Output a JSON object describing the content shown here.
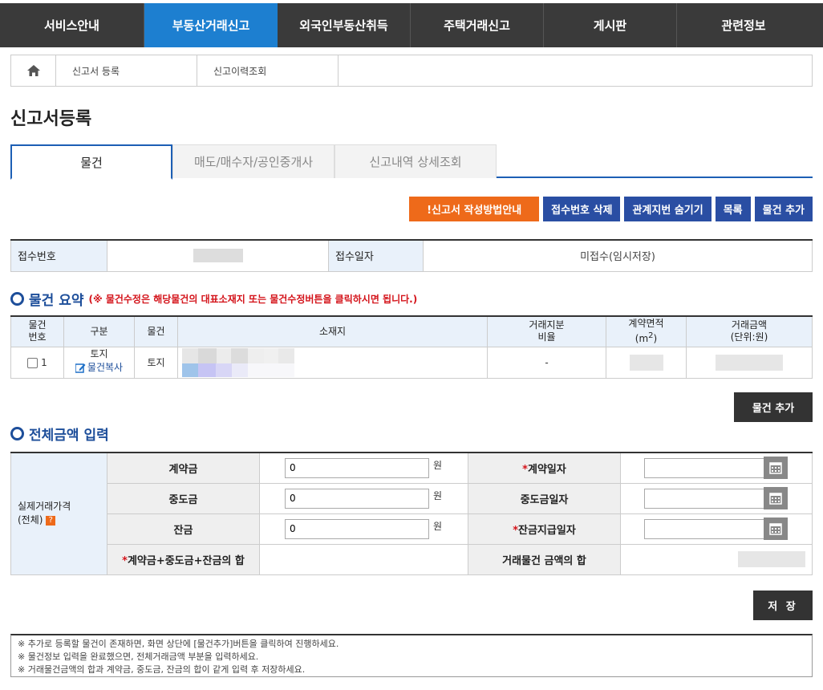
{
  "nav": {
    "items": [
      {
        "label": "서비스안내"
      },
      {
        "label": "부동산거래신고"
      },
      {
        "label": "외국인부동산취득"
      },
      {
        "label": "주택거래신고"
      },
      {
        "label": "게시판"
      },
      {
        "label": "관련정보"
      }
    ],
    "active_index": 1
  },
  "breadcrumb": {
    "items": [
      "신고서 등록",
      "신고이력조회"
    ]
  },
  "page_title": "신고서등록",
  "tabs": [
    {
      "label": "물건"
    },
    {
      "label": "매도/매수자/공인중개사"
    },
    {
      "label": "신고내역 상세조회"
    }
  ],
  "actions": {
    "guide": "!신고서 작성방법안내",
    "delete_receipt": "접수번호 삭제",
    "hide_lot": "관계지번 숨기기",
    "list": "목록",
    "add_item": "물건 추가"
  },
  "info": {
    "receipt_no_label": "접수번호",
    "receipt_date_label": "접수일자",
    "receipt_date_value": "미접수(임시저장)"
  },
  "summary": {
    "title": "물건 요약",
    "note": "(※ 물건수정은 해당물건의 대표소재지 또는 물건수정버튼을 클릭하시면 됩니다.)",
    "headers": {
      "no": "물건\n번호",
      "type": "구분",
      "item": "물건",
      "location": "소재지",
      "share": "거래지분\n비율",
      "area": "계약면적",
      "area_unit": "(m",
      "area_sup": "2",
      "area_close": ")",
      "amount": "거래금액",
      "amount_unit": "(단위:원)"
    },
    "rows": [
      {
        "no": "1",
        "type": "토지",
        "copy_label": "물건복사",
        "item": "토지",
        "share": "-"
      }
    ],
    "add_button": "물건 추가"
  },
  "amount": {
    "title": "전체금액 입력",
    "row_header_line1": "실제거래가격",
    "row_header_line2": "(전체)",
    "deposit_label": "계약금",
    "middle_label": "중도금",
    "balance_label": "잔금",
    "deposit_value": "0",
    "middle_value": "0",
    "balance_value": "0",
    "won": "원",
    "contract_date_label": "계약일자",
    "middle_date_label": "중도금일자",
    "balance_date_label": "잔금지급일자",
    "sum_label": "계약금+중도금+잔금의 합",
    "item_sum_label": "거래물건 금액의 합",
    "asterisk": "*"
  },
  "save_button": "저 장",
  "notes": [
    "※ 추가로 등록할 물건이 존재하면, 화면 상단에 [물건추가]버튼을 클릭하여 진행하세요.",
    "※ 물건정보 입력을 완료했으면, 전체거래금액 부분을 입력하세요.",
    "※ 거래물건금액의 합과 계약금, 중도금, 잔금의 합이 같게 입력 후 저장하세요."
  ],
  "colors": {
    "nav_bg": "#3a3a3a",
    "nav_active": "#1d7fd0",
    "accent_blue": "#2a4ea3",
    "accent_orange": "#ee6a1a",
    "section_title": "#1d4e9a",
    "required_red": "#d4141b"
  }
}
